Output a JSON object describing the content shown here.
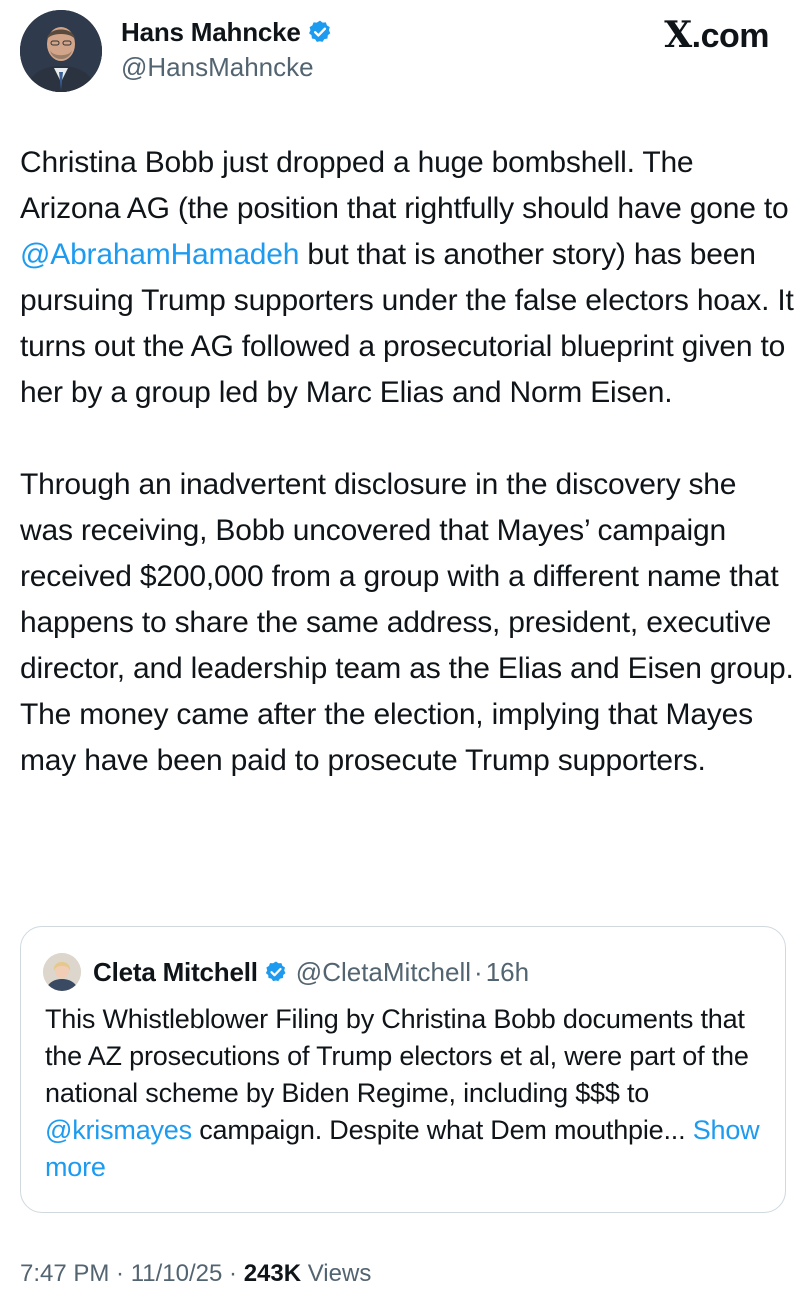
{
  "author": {
    "name": "Hans Mahncke",
    "handle": "@HansMahncke",
    "verified": true
  },
  "site_logo": {
    "x": "X",
    "suffix": ".com"
  },
  "tweet": {
    "p1_a": "Christina Bobb just dropped a huge bombshell. The Arizona AG (the position that rightfully should have gone to ",
    "p1_mention": "@AbrahamHamadeh",
    "p1_b": " but that is another story) has been pursuing Trump supporters under the false electors hoax. It turns out the AG followed a prosecutorial blueprint given to her by a group led by Marc Elias and Norm Eisen.",
    "p2": "Through an inadvertent disclosure in the discovery she was receiving, Bobb uncovered that Mayes’ campaign received $200,000 from a group with a different name that happens to share the same address, president, executive director, and leadership team as the Elias and Eisen group. The money came after the election, implying that Mayes may have been paid to prosecute Trump supporters."
  },
  "quote": {
    "name": "Cleta Mitchell",
    "verified": true,
    "handle": "@CletaMitchell",
    "separator": "·",
    "time": "16h",
    "text_a": "This Whistleblower Filing by Christina Bobb documents that the AZ prosecutions of Trump electors et al, were part of the national scheme by Biden Regime, including $$$  to ",
    "text_mention": "@krismayes",
    "text_b": " campaign. Despite what Dem mouthpie...",
    "show_more": "Show more"
  },
  "meta": {
    "time": "7:47 PM",
    "sep1": " · ",
    "date": "11/10/25",
    "sep2": " · ",
    "views_count": "243K",
    "views_label": " Views"
  },
  "colors": {
    "link": "#1d9bf0",
    "muted": "#536471",
    "text": "#0f1419",
    "border": "#cfd9de"
  },
  "icons": {
    "verified": "verified-badge-icon"
  }
}
